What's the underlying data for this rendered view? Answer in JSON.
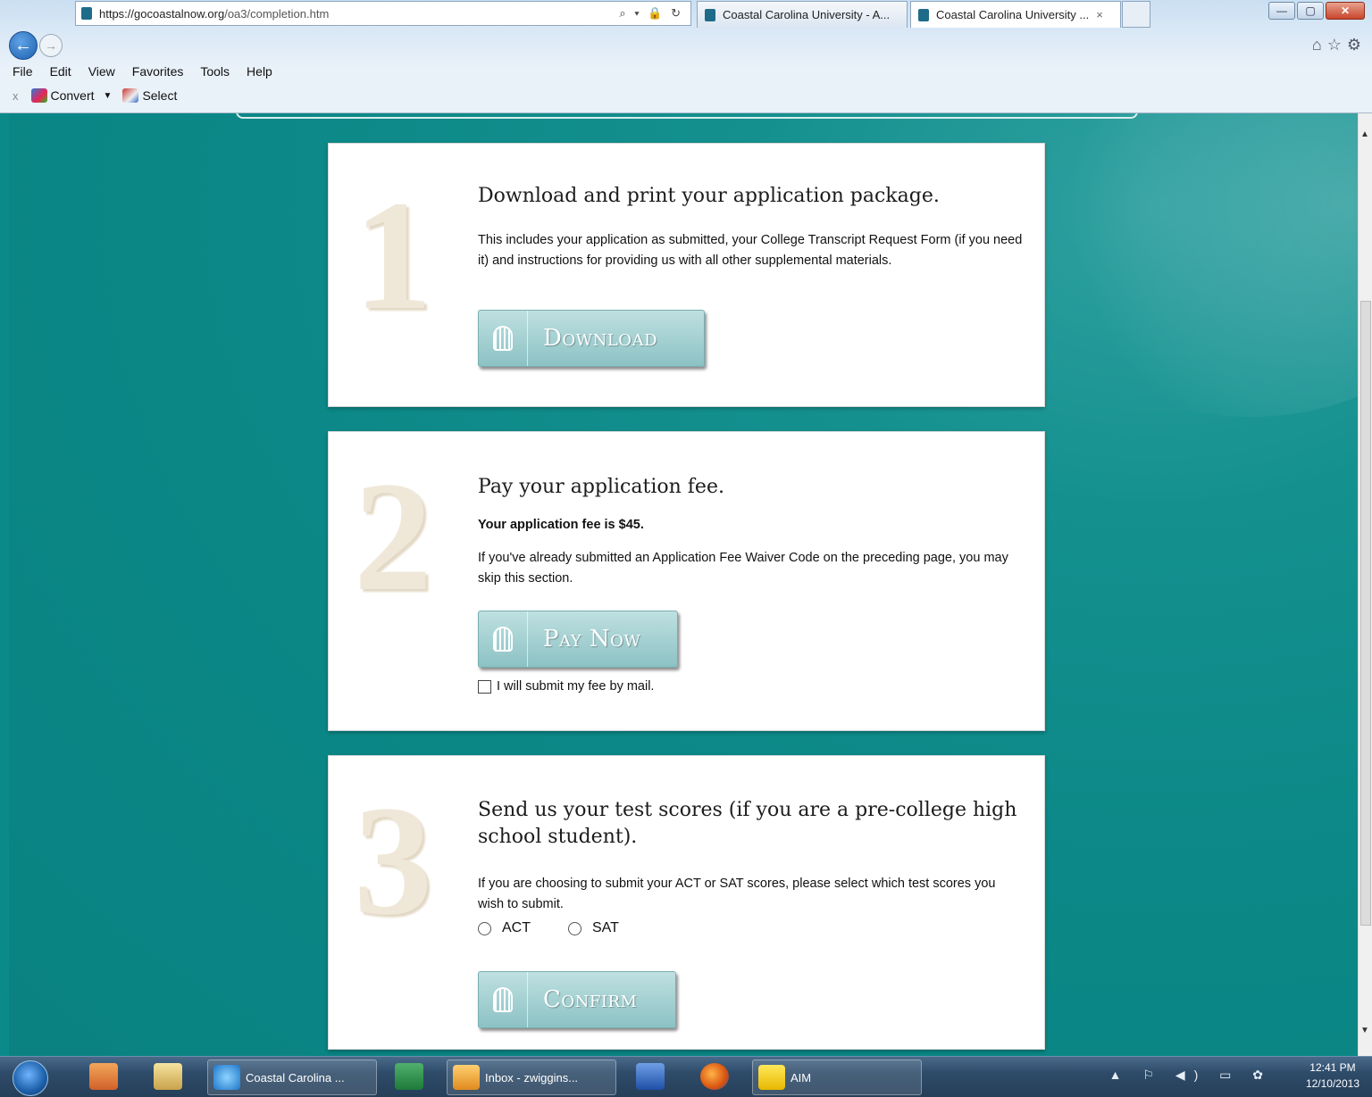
{
  "browser": {
    "url_host": "https://gocoastalnow.org",
    "url_path": "/oa3/completion.htm",
    "url_tools": "⌕ ▾ 🔒 ↻",
    "tabs": [
      {
        "label": "Coastal Carolina University - A...",
        "active": false
      },
      {
        "label": "Coastal Carolina University ...",
        "active": true
      }
    ],
    "tab_close": "×",
    "window_buttons": {
      "minimize": "—",
      "maximize": "▢",
      "close": "✕"
    },
    "menu": [
      "File",
      "Edit",
      "View",
      "Favorites",
      "Tools",
      "Help"
    ],
    "commandbar": {
      "close": "x",
      "convert": "Convert",
      "select": "Select"
    },
    "right_icons": "⌂☆⚙"
  },
  "steps": [
    {
      "number": "1",
      "heading": "Download and print your application package.",
      "text": "This includes your application as submitted, your College Transcript Request Form (if you need it) and instructions for providing us with all other supplemental materials.",
      "button": "Download"
    },
    {
      "number": "2",
      "heading": "Pay your application fee.",
      "fee_text": "Your application fee is $45.",
      "text": "If you've already submitted an Application Fee Waiver Code on the preceding page, you may skip this section.",
      "button": "Pay Now",
      "checkbox_label": "I will submit my fee by mail.",
      "checkbox_checked": false
    },
    {
      "number": "3",
      "heading": "Send us your test scores (if you are a pre-college high school student).",
      "text": "If you are choosing to submit your ACT or SAT scores, please select which test scores you wish to submit.",
      "options": [
        "ACT",
        "SAT"
      ],
      "button": "Confirm"
    }
  ],
  "taskbar": {
    "ie_label": "Coastal Carolina ...",
    "outlook_label": "Inbox - zwiggins...",
    "aim_label": "AIM",
    "time": "12:41 PM",
    "date": "12/10/2013",
    "tray_icons": "▲ ⚐ ◀) ▭ ✿"
  },
  "colors": {
    "page_bg": "#0b8a8a",
    "button_bg": "#9ccbcc",
    "numeral": "#efe7d8"
  }
}
